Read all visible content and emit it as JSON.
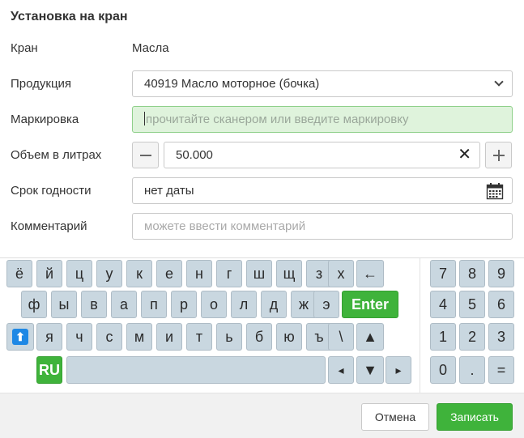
{
  "dialog": {
    "title": "Установка на кран"
  },
  "form": {
    "crane": {
      "label": "Кран",
      "value": "Масла"
    },
    "product": {
      "label": "Продукция",
      "value": "40919 Масло моторное (бочка)"
    },
    "marking": {
      "label": "Маркировка",
      "placeholder": "прочитайте сканером или введите маркировку"
    },
    "volume": {
      "label": "Объем в литрах",
      "value": "50.000"
    },
    "expiry": {
      "label": "Срок годности",
      "value": "нет даты"
    },
    "comment": {
      "label": "Комментарий",
      "placeholder": "можете ввести комментарий"
    }
  },
  "keyboard": {
    "row1": [
      "ё",
      "й",
      "ц",
      "у",
      "к",
      "е",
      "н",
      "г",
      "ш",
      "щ",
      "з",
      "х",
      "←"
    ],
    "row2": [
      "ф",
      "ы",
      "в",
      "а",
      "п",
      "р",
      "о",
      "л",
      "д",
      "ж",
      "э"
    ],
    "enter": "Enter",
    "row3": [
      "я",
      "ч",
      "с",
      "м",
      "и",
      "т",
      "ь",
      "б",
      "ю",
      "ъ",
      "\\",
      "▲"
    ],
    "shift": "🠉",
    "lang": "RU",
    "arrows": [
      "◂",
      "▼",
      "▸"
    ],
    "numpad": [
      [
        "7",
        "8",
        "9"
      ],
      [
        "4",
        "5",
        "6"
      ],
      [
        "1",
        "2",
        "3"
      ],
      [
        "0",
        ".",
        "="
      ]
    ]
  },
  "footer": {
    "cancel_label": "Отмена",
    "save_label": "Записать"
  },
  "colors": {
    "accent": "#3fb33b",
    "key": "#c9d7e0",
    "shift": "#1e88e5"
  }
}
